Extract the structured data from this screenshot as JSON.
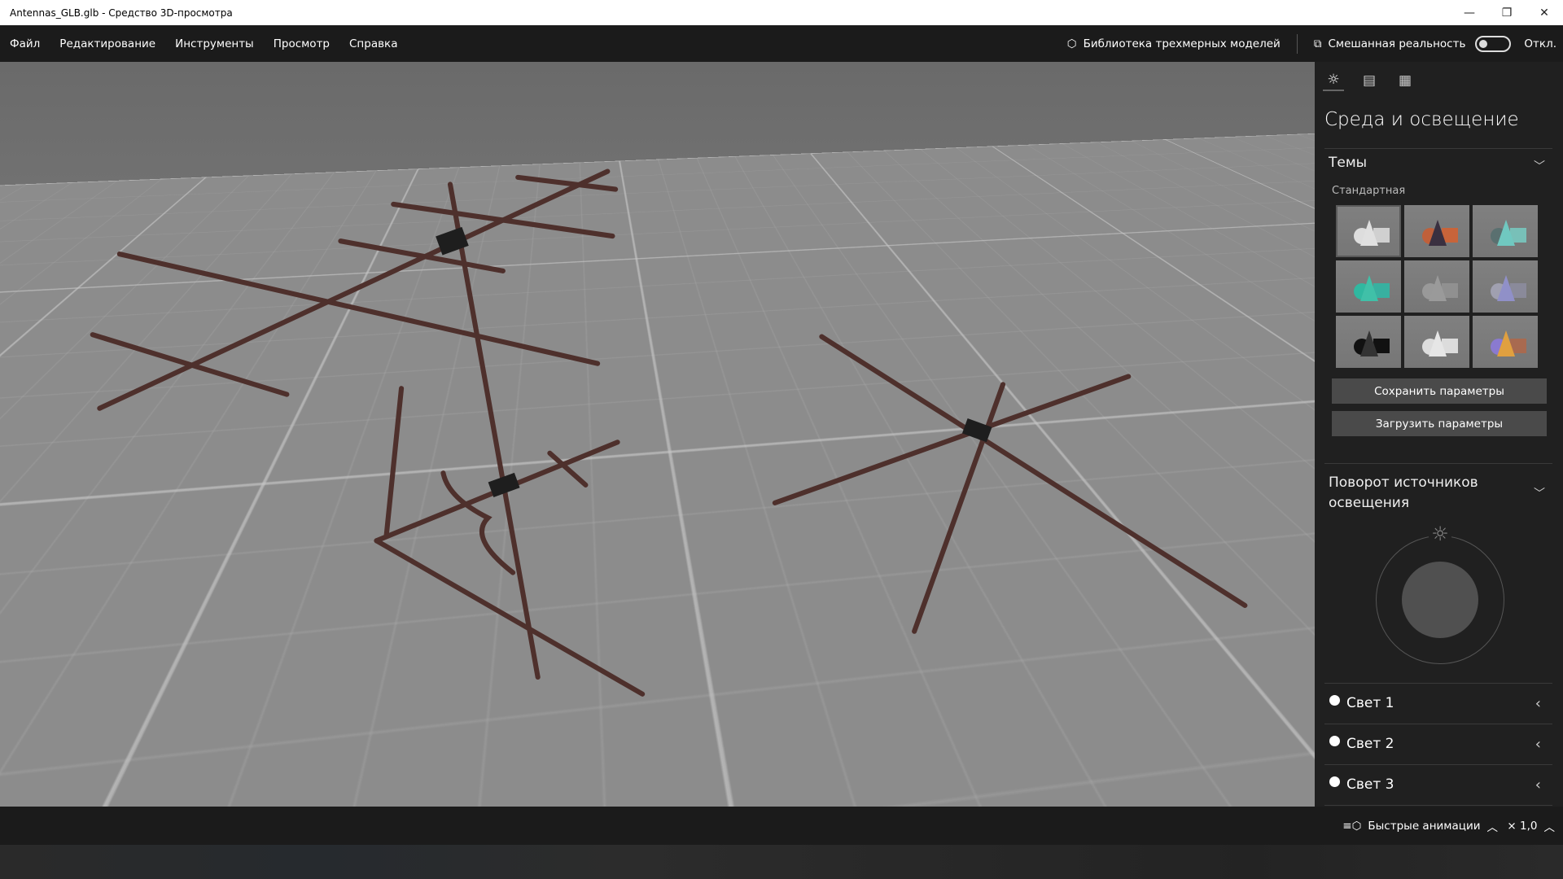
{
  "window": {
    "title": "Antennas_GLB.glb - Средство 3D-просмотра",
    "minimize": "—",
    "restore": "❐",
    "close": "✕"
  },
  "menu": {
    "items": [
      "Файл",
      "Редактирование",
      "Инструменты",
      "Просмотр",
      "Справка"
    ],
    "library": "Библиотека трехмерных моделей",
    "mixed_reality": "Смешанная реальность",
    "toggle_state": "Откл."
  },
  "panel": {
    "tabs": [
      "lighting",
      "stats",
      "grid"
    ],
    "title": "Среда и освещение",
    "themes": {
      "header": "Темы",
      "subheader": "Стандартная",
      "tiles": [
        {
          "s": "#ddd",
          "c": "#e0e0e0",
          "b": "#d0d0d0"
        },
        {
          "s": "#c0603a",
          "c": "#3a3040",
          "b": "#c8643a"
        },
        {
          "s": "#5a7070",
          "c": "#70c8c0",
          "b": "#78c0b8"
        },
        {
          "s": "#30b8a0",
          "c": "#40c0a8",
          "b": "#38b0a0"
        },
        {
          "s": "#999",
          "c": "#9a9a9a",
          "b": "#909090"
        },
        {
          "s": "#a0a0b0",
          "c": "#9090c8",
          "b": "#8a8a9a"
        },
        {
          "s": "#111",
          "c": "#333",
          "b": "#111"
        },
        {
          "s": "#ddd",
          "c": "#e6e6e6",
          "b": "#dcdcdc"
        },
        {
          "s": "#8a7ad0",
          "c": "#e0a040",
          "b": "#a86a50"
        }
      ]
    },
    "save": "Сохранить параметры",
    "load": "Загрузить параметры",
    "rotation": {
      "header_line1": "Поворот источников",
      "header_line2": "освещения"
    },
    "lights": [
      "Свет 1",
      "Свет 2",
      "Свет 3"
    ]
  },
  "bottom": {
    "animations": "Быстрые анимации",
    "speed": "× 1,0"
  }
}
